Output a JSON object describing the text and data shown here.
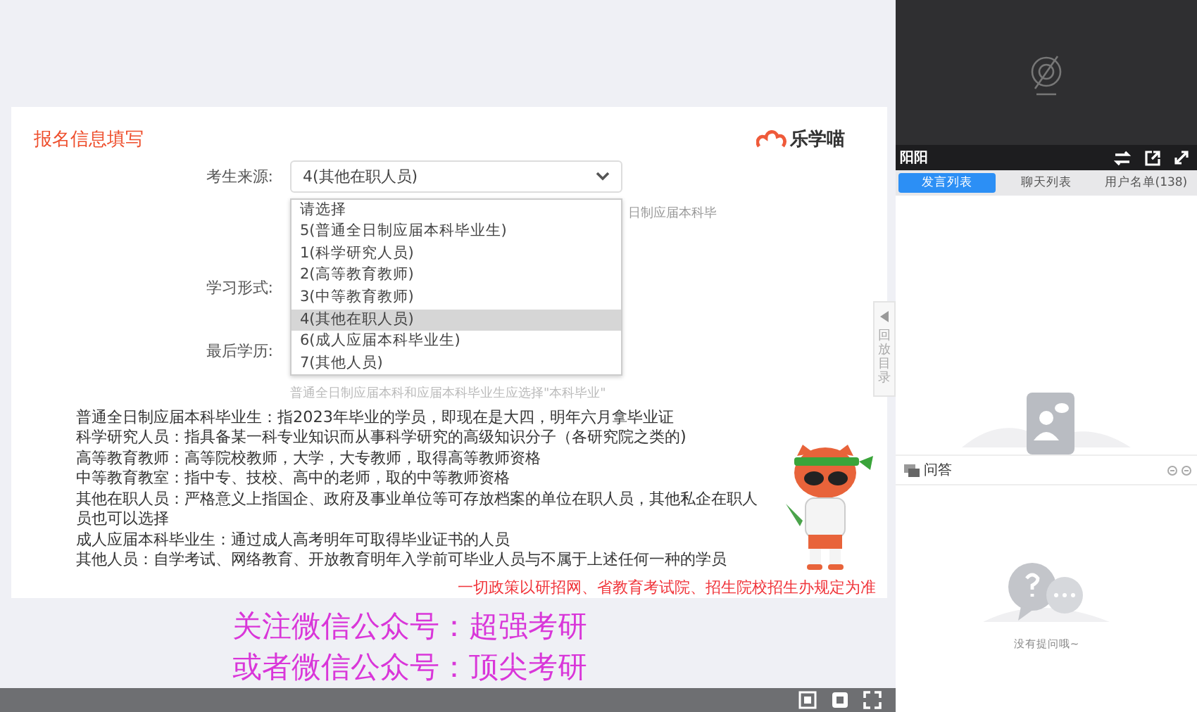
{
  "slide": {
    "title": "报名信息填写",
    "logo": "乐学喵",
    "form": {
      "source_label": "考生来源:",
      "source_value": "4(其他在职人员)",
      "study_label": "学习形式:",
      "degree_label": "最后学历:",
      "hint_right": "日制应届本科毕",
      "hint_below": "普通全日制应届本科和应届本科毕业生应选择\"本科毕业\"",
      "options": [
        {
          "label": "请选择",
          "selected": false
        },
        {
          "label": "5(普通全日制应届本科毕业生)",
          "selected": false
        },
        {
          "label": "1(科学研究人员)",
          "selected": false
        },
        {
          "label": "2(高等教育教师)",
          "selected": false
        },
        {
          "label": "3(中等教育教师)",
          "selected": false
        },
        {
          "label": "4(其他在职人员)",
          "selected": true
        },
        {
          "label": "6(成人应届本科毕业生)",
          "selected": false
        },
        {
          "label": "7(其他人员)",
          "selected": false
        }
      ]
    },
    "notes": [
      "普通全日制应届本科毕业生：指2023年毕业的学员，即现在是大四，明年六月拿毕业证",
      "科学研究人员：指具备某一科专业知识而从事科学研究的高级知识分子（各研究院之类的)",
      "高等教育教师：高等院校教师，大学，大专教师，取得高等教师资格",
      "中等教育教室：指中专、技校、高中的老师，取的中等教师资格",
      "其他在职人员：严格意义上指国企、政府及事业单位等可存放档案的单位在职人员，其他私企在职人员也可以选择",
      "成人应届本科毕业生：通过成人高考明年可取得毕业证书的人员",
      "其他人员：自学考试、网络教育、开放教育明年入学前可毕业人员与不属于上述任何一种的学员"
    ],
    "disclaimer": "一切政策以研招网、省教育考试院、招生院校招生办规定为准"
  },
  "side_tab": "回放目录",
  "overlay_lines": [
    "关注微信公众号：超强考研",
    "或者微信公众号：顶尖考研"
  ],
  "presenter": "阳阳",
  "tabs": [
    {
      "label": "发言列表",
      "selected": true
    },
    {
      "label": "聊天列表",
      "selected": false
    },
    {
      "label": "用户名单(138)",
      "selected": false
    }
  ],
  "qa": {
    "title": "问答",
    "empty": "没有提问哦~"
  }
}
